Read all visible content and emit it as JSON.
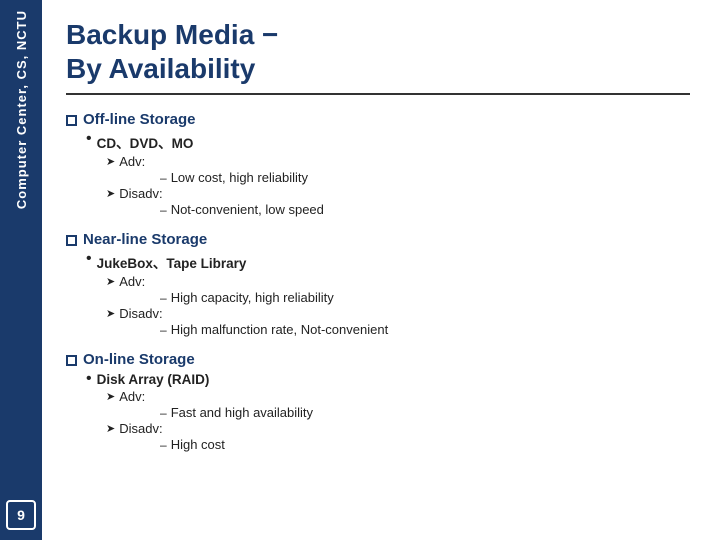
{
  "sidebar": {
    "label": "Computer Center, CS, NCTU",
    "number": "9"
  },
  "header": {
    "title_line1": "Backup Media −",
    "title_line2": "     By Availability"
  },
  "sections": [
    {
      "id": "off-line",
      "title": "Off-line Storage",
      "sub_items": [
        {
          "label": "CD、DVD、MO",
          "adv_label": "Adv:",
          "adv_details": [
            "Low cost, high reliability"
          ],
          "disadv_label": "Disadv:",
          "disadv_details": [
            "Not-convenient, low speed"
          ]
        }
      ]
    },
    {
      "id": "near-line",
      "title": "Near-line Storage",
      "sub_items": [
        {
          "label": "JukeBox、Tape Library",
          "adv_label": "Adv:",
          "adv_details": [
            "High capacity, high reliability"
          ],
          "disadv_label": "Disadv:",
          "disadv_details": [
            "High malfunction rate, Not-convenient"
          ]
        }
      ]
    },
    {
      "id": "on-line",
      "title": "On-line Storage",
      "sub_items": [
        {
          "label": "Disk Array (RAID)",
          "adv_label": "Adv:",
          "adv_details": [
            "Fast and high availability"
          ],
          "disadv_label": "Disadv:",
          "disadv_details": [
            "High cost"
          ]
        }
      ]
    }
  ]
}
